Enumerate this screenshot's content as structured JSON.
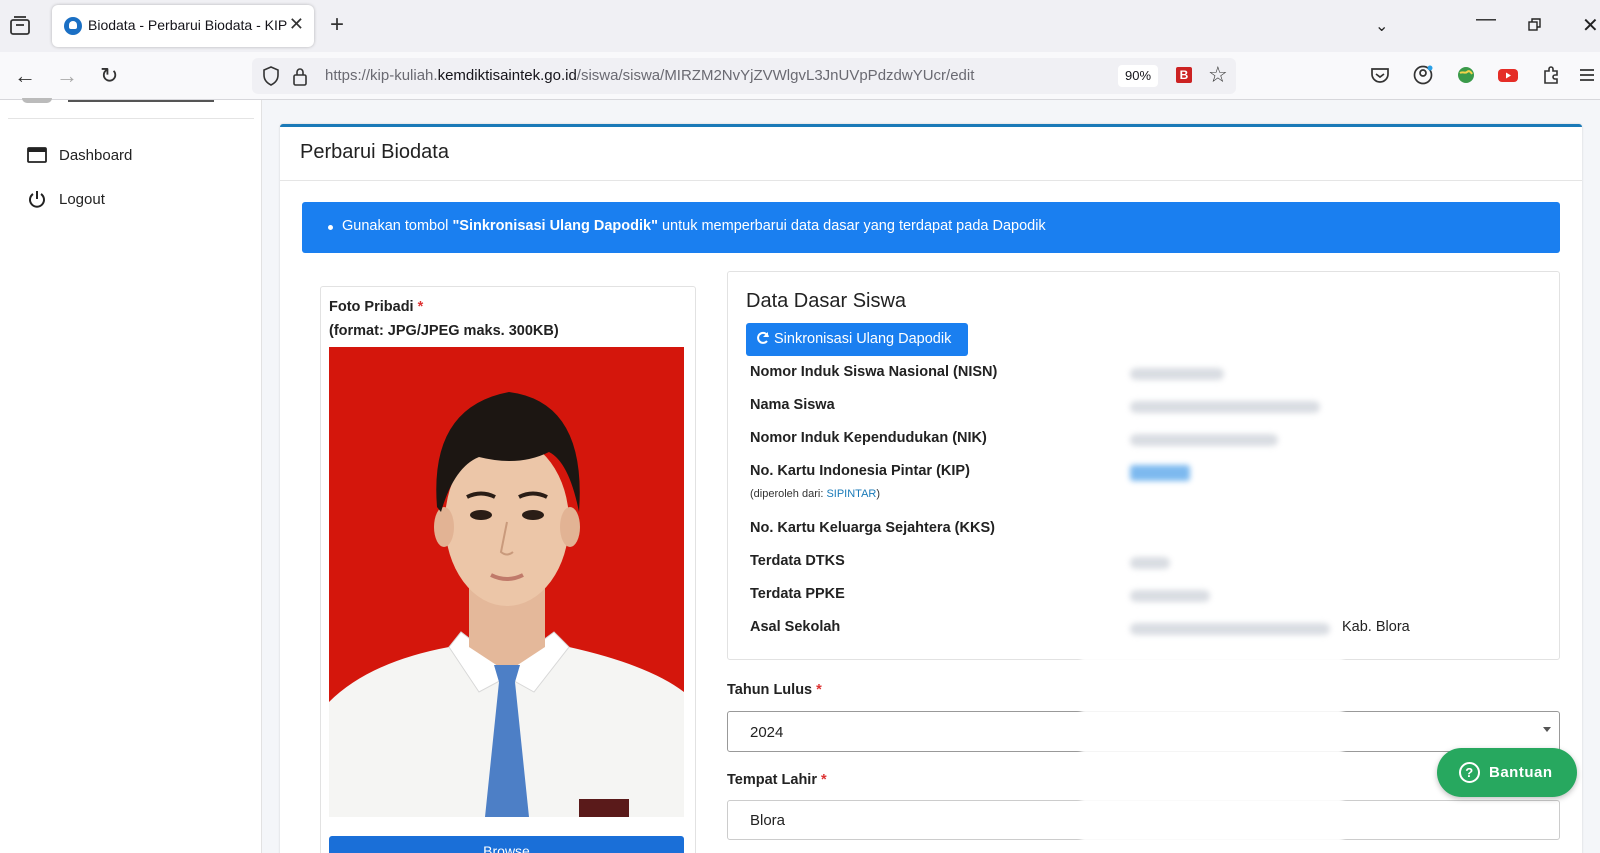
{
  "browser": {
    "tab_title": "Biodata - Perbarui Biodata - KIP",
    "url_prefix": "https://kip-kuliah.",
    "url_domain": "kemdiktisaintek.go.id",
    "url_path": "/siswa/siswa/MIRZM2NvYjZVWlgvL3JnUVpPdzdwYUcr/edit",
    "zoom": "90%",
    "ext_label": "B"
  },
  "sidebar": {
    "items": [
      {
        "label": "Dashboard",
        "icon": "window-icon"
      },
      {
        "label": "Logout",
        "icon": "power-icon"
      }
    ]
  },
  "page": {
    "title": "Perbarui Biodata",
    "alert_prefix": "Gunakan tombol ",
    "alert_bold": "\"Sinkronisasi Ulang Dapodik\"",
    "alert_suffix": " untuk memperbarui data dasar yang terdapat pada Dapodik"
  },
  "photo": {
    "label_line1": "Foto Pribadi",
    "required_mark": "*",
    "label_line2": "(format: JPG/JPEG maks. 300KB)",
    "upload_label": "Browse"
  },
  "data_dasar": {
    "title": "Data Dasar Siswa",
    "sync_button": "Sinkronisasi Ulang Dapodik",
    "rows": [
      {
        "label": "Nomor Induk Siswa Nasional (NISN)"
      },
      {
        "label": "Nama Siswa"
      },
      {
        "label": "Nomor Induk Kependudukan (NIK)"
      },
      {
        "label": "No. Kartu Indonesia Pintar (KIP)"
      },
      {
        "label": "No. Kartu Keluarga Sejahtera (KKS)"
      },
      {
        "label": "Terdata DTKS"
      },
      {
        "label": "Terdata PPKE"
      },
      {
        "label": "Asal Sekolah",
        "value": "Kab. Blora"
      }
    ],
    "kip_note_prefix": "(diperoleh dari: ",
    "kip_note_link": "SIPINTAR",
    "kip_note_suffix": ")"
  },
  "form": {
    "tahun_lulus_label": "Tahun Lulus",
    "tahun_lulus_value": "2024",
    "tempat_lahir_label": "Tempat Lahir",
    "tempat_lahir_value": "Blora",
    "required_mark": "*"
  },
  "help": {
    "label": "Bantuan",
    "icon": "?"
  },
  "colors": {
    "primary": "#1a7ff0",
    "help": "#27a85f",
    "photo_bg": "#d4160c",
    "card_top": "#1a7ab8"
  }
}
